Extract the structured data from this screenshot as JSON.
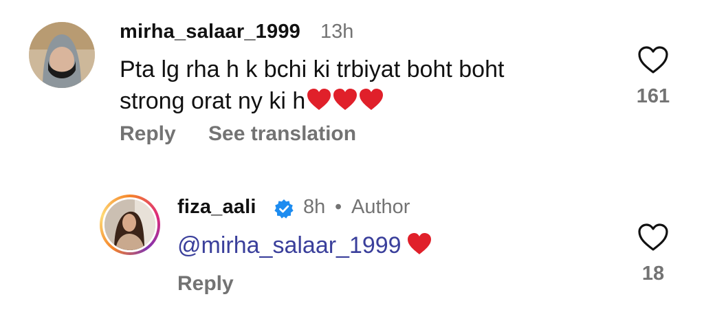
{
  "comment1": {
    "username": "mirha_salaar_1999",
    "time": "13h",
    "text_line1": "Pta lg rha h k bchi ki trbiyat boht boht",
    "text_line2": "strong orat ny ki h",
    "emojis": [
      "red-heart",
      "red-heart",
      "red-heart"
    ],
    "reply_label": "Reply",
    "translate_label": "See translation",
    "like_count": "161"
  },
  "comment2": {
    "username": "fiza_aali",
    "verified": true,
    "time": "8h",
    "separator": "•",
    "author_label": "Author",
    "mention": "@mirha_salaar_1999",
    "emojis": [
      "red-heart"
    ],
    "reply_label": "Reply",
    "like_count": "18"
  },
  "colors": {
    "text": "#111111",
    "muted": "#737373",
    "mention": "#3a3f9b",
    "heart": "#e0202a",
    "verified": "#1d8cf0"
  }
}
